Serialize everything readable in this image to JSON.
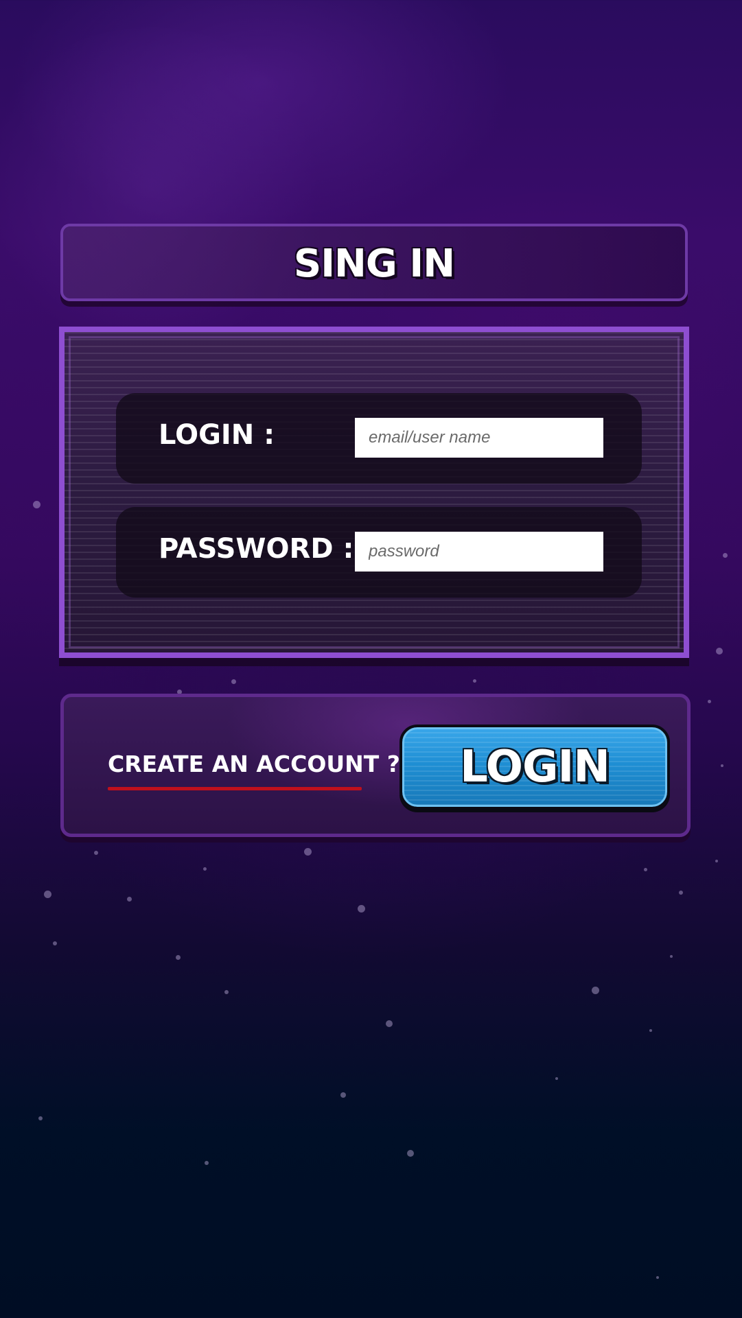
{
  "title": "SING IN",
  "form": {
    "login_label": "LOGIN :",
    "login_placeholder": "email/user name",
    "password_label": "PASSWORD :",
    "password_placeholder": "password"
  },
  "actions": {
    "create_account": "CREATE AN ACCOUNT ?",
    "login_button": "LOGIN"
  },
  "colors": {
    "panel_border": "#8e4ed1",
    "button_blue": "#1f8fd4",
    "underline_red": "#c0101c",
    "background_top": "#2a0c5e",
    "background_bottom": "#000d24"
  }
}
